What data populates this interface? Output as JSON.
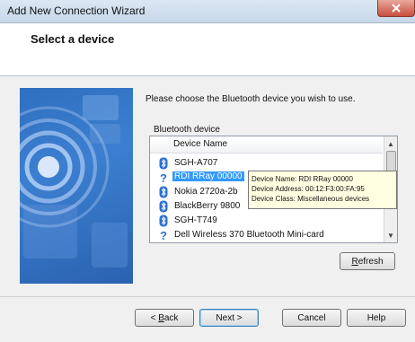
{
  "window": {
    "title": "Add New Connection Wizard"
  },
  "header": {
    "heading": "Select a device"
  },
  "main": {
    "instruction": "Please choose the Bluetooth device you wish to use.",
    "group_label": "Bluetooth device",
    "column_header": "Device Name",
    "devices": [
      {
        "label": "SGH-A707",
        "icon": "bluetooth-icon"
      },
      {
        "label": "RDI RRay 00000",
        "icon": "unknown-device-icon",
        "selected": true
      },
      {
        "label": "Nokia 2720a-2b",
        "icon": "bluetooth-icon"
      },
      {
        "label": "BlackBerry 9800",
        "icon": "bluetooth-icon"
      },
      {
        "label": "SGH-T749",
        "icon": "bluetooth-icon"
      },
      {
        "label": "Dell Wireless 370 Bluetooth Mini-card",
        "icon": "unknown-device-icon"
      }
    ],
    "tooltip": {
      "line1": "Device Name: RDI RRay 00000",
      "line2": "Device Address: 00:12:F3:00:FA:95",
      "line3": "Device Class: Miscellaneous devices"
    },
    "refresh_prefix": "",
    "refresh_mnemonic": "R",
    "refresh_rest": "efresh"
  },
  "footer": {
    "back_prefix": "< ",
    "back_mnemonic": "B",
    "back_rest": "ack",
    "next_label": "Next >",
    "cancel_label": "Cancel",
    "help_label": "Help"
  },
  "colors": {
    "selection": "#3399ff",
    "tooltip_bg": "#ffffe1",
    "bluetooth": "#2a6fd1"
  }
}
